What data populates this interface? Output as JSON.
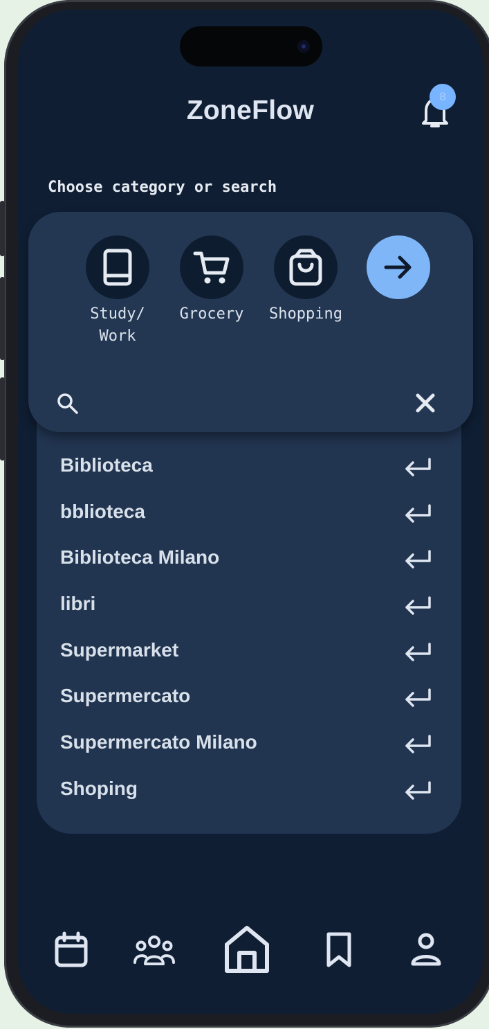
{
  "app": {
    "title": "ZoneFlow"
  },
  "notifications": {
    "badge_count": "8"
  },
  "subtitle": "Choose category or search",
  "categories": [
    {
      "label": "Study/\nWork",
      "icon": "book-icon"
    },
    {
      "label": "Grocery",
      "icon": "cart-icon"
    },
    {
      "label": "Shopping",
      "icon": "shopping-bag-icon"
    }
  ],
  "next_button": {
    "icon": "arrow-right-icon"
  },
  "search": {
    "value": "",
    "placeholder": ""
  },
  "suggestions": [
    "Biblioteca",
    "bblioteca",
    "Biblioteca Milano",
    "libri",
    "Supermarket",
    "Supermercato",
    "Supermercato Milano",
    "Shoping"
  ],
  "bottom_nav": [
    {
      "icon": "calendar-icon"
    },
    {
      "icon": "people-icon"
    },
    {
      "icon": "home-icon"
    },
    {
      "icon": "bookmark-icon"
    },
    {
      "icon": "profile-icon"
    }
  ],
  "colors": {
    "background": "#0f1e33",
    "card": "#233753",
    "accent": "#7fb6f8",
    "text": "#dfe6f2"
  }
}
